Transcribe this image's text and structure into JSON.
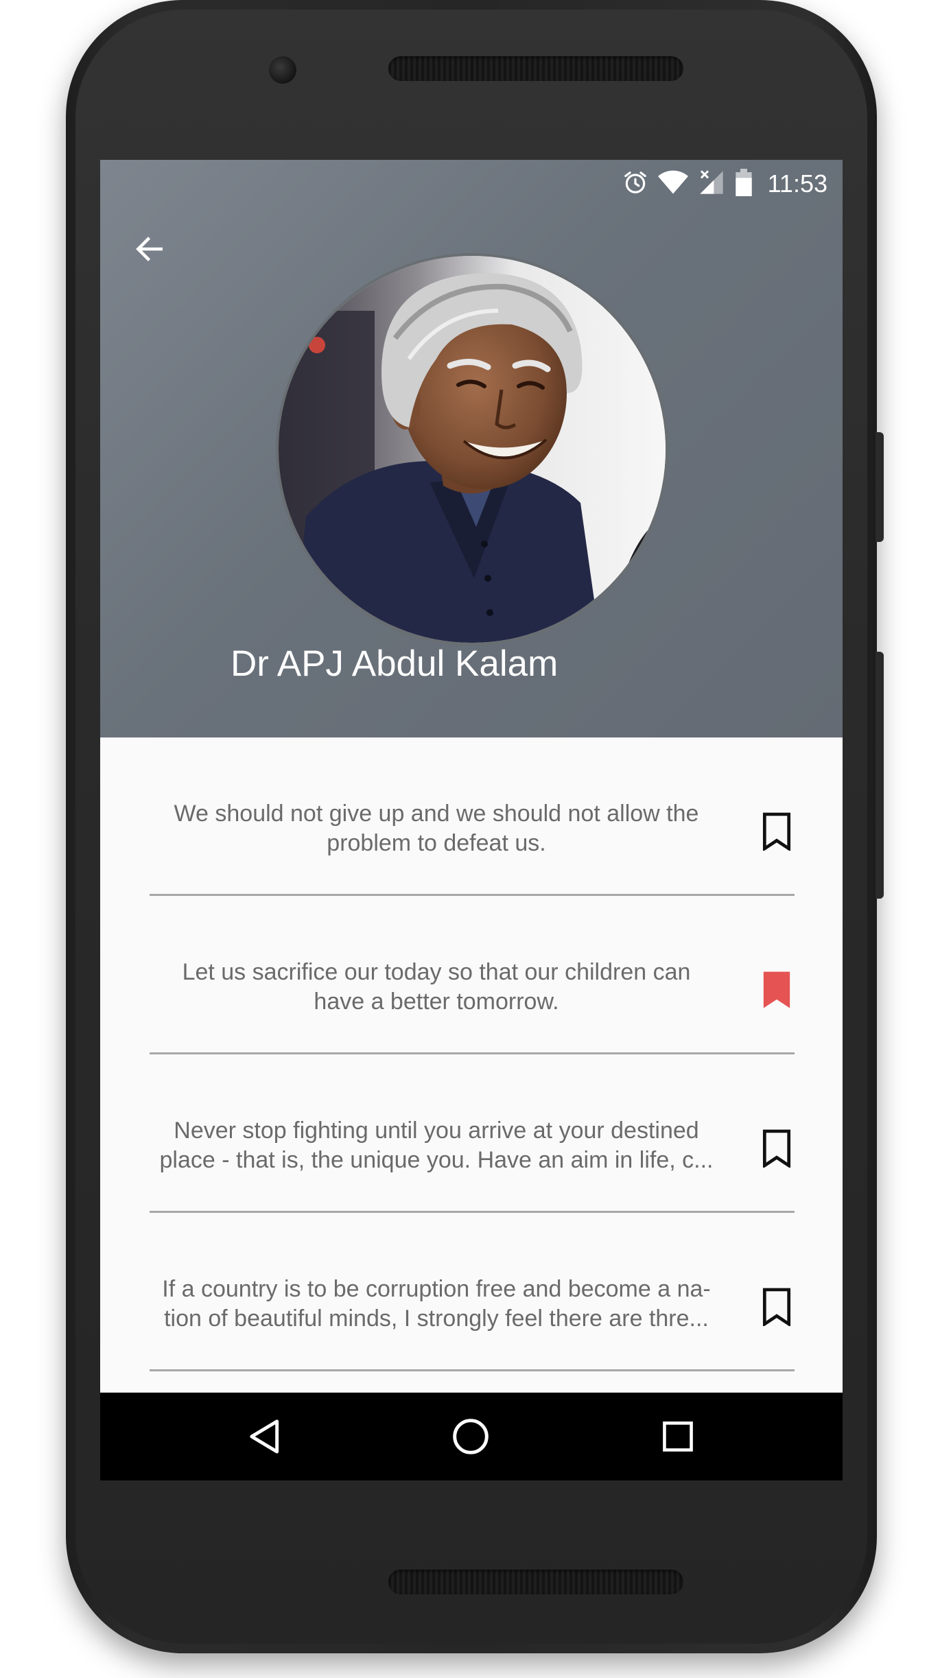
{
  "status_bar": {
    "time": "11:53",
    "icons": [
      "alarm-icon",
      "wifi-icon",
      "signal-icon",
      "battery-icon"
    ]
  },
  "header": {
    "back_icon": "arrow-left-icon",
    "name": "Dr APJ Abdul Kalam"
  },
  "quotes": [
    {
      "text": "We should not give up and we should not allow the\nproblem to defeat us.",
      "bookmarked": false
    },
    {
      "text": "Let us sacrifice our today so that our children can\nhave a better tomorrow.",
      "bookmarked": true
    },
    {
      "text": "Never stop fighting until you arrive at your destined\nplace - that is, the unique you. Have an aim in life, c...",
      "bookmarked": false
    },
    {
      "text": "If a country is to be corruption free and become a na-\ntion of beautiful minds, I strongly feel there are thre...",
      "bookmarked": false
    }
  ],
  "colors": {
    "header_bg": "#69717a",
    "bookmark_active": "#e55353",
    "bookmark_inactive": "#111111",
    "quote_text": "#6a6a6a",
    "divider": "#a7a7a7"
  },
  "nav": {
    "back_icon": "triangle-back-icon",
    "home_icon": "circle-home-icon",
    "recent_icon": "square-recents-icon"
  }
}
